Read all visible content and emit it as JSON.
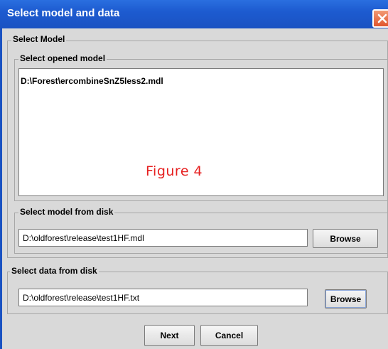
{
  "window": {
    "title": "Select model and data"
  },
  "select_model": {
    "legend": "Select Model",
    "opened": {
      "legend": "Select opened model",
      "items": [
        "D:\\Forest\\ercombineSnZ5less2.mdl"
      ]
    },
    "disk": {
      "legend": "Select model from disk",
      "path": "D:\\oldforest\\release\\test1HF.mdl",
      "browse_label": "Browse"
    }
  },
  "select_data": {
    "legend": "Select data from disk",
    "path": "D:\\oldforest\\release\\test1HF.txt",
    "browse_label": "Browse"
  },
  "overlay": {
    "figure_label": "Figure 4",
    "color": "#e62020"
  },
  "footer": {
    "next_label": "Next",
    "cancel_label": "Cancel"
  },
  "colors": {
    "titlebar": "#1d5bd0",
    "panel": "#d9d9d9"
  }
}
